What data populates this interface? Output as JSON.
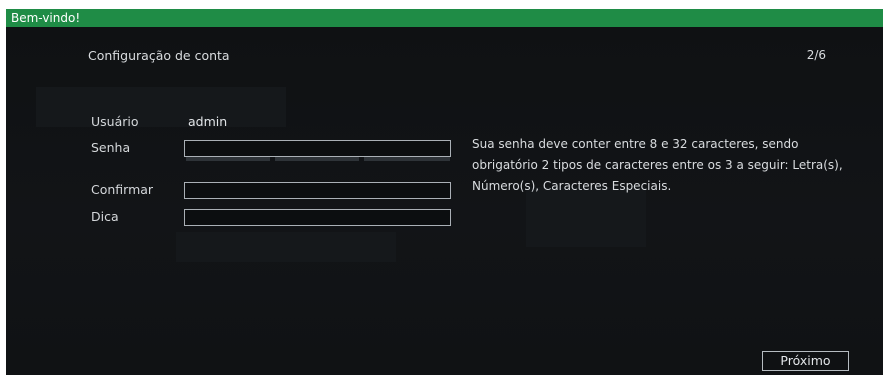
{
  "window": {
    "title": "Bem-vindo!"
  },
  "header": {
    "page_title": "Configuração de conta",
    "step": "2/6"
  },
  "form": {
    "user_label": "Usuário",
    "user_value": "admin",
    "password_label": "Senha",
    "password_value": "",
    "confirm_label": "Confirmar",
    "confirm_value": "",
    "hint_label": "Dica",
    "hint_value": ""
  },
  "password_rules": {
    "text": "Sua senha deve conter entre 8 e 32 caracteres, sendo obrigatório 2 tipos de caracteres entre os 3 a seguir: Letra(s), Número(s), Caracteres Especiais."
  },
  "strength_meter": {
    "segments": 3,
    "level": 0
  },
  "footer": {
    "next_label": "Próximo"
  },
  "colors": {
    "titlebar": "#1f8c46",
    "background": "#111315",
    "text": "#d9dcdf",
    "field_border": "#aab0b6"
  }
}
